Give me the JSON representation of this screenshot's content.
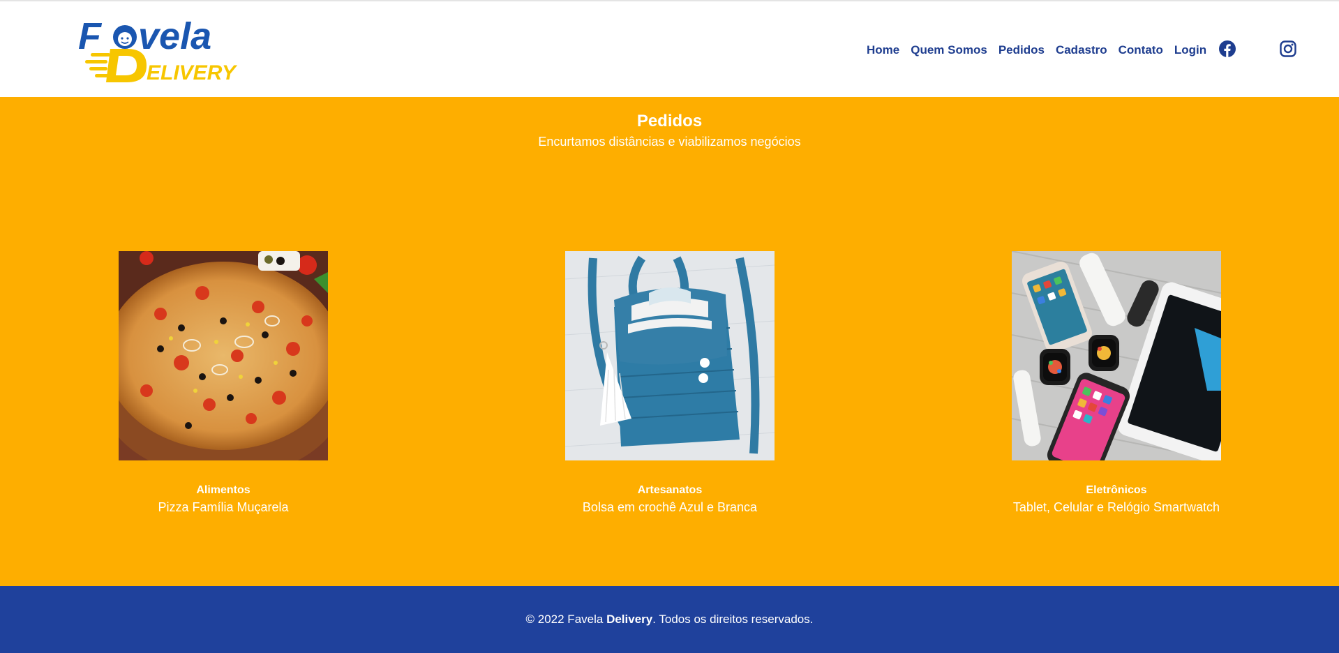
{
  "header": {
    "logo": {
      "word_top": "Favela",
      "word_bottom": "DELIVERY",
      "colors": {
        "blue": "#1a56b0",
        "yellow": "#f7c600"
      }
    },
    "nav": [
      "Home",
      "Quem Somos",
      "Pedidos",
      "Cadastro",
      "Contato",
      "Login"
    ],
    "social": [
      {
        "icon": "facebook-icon",
        "color": "#1e3d8f"
      },
      {
        "icon": "instagram-icon",
        "color": "#1e3d8f"
      }
    ]
  },
  "main": {
    "title": "Pedidos",
    "subtitle": "Encurtamos distâncias e viabilizamos negócios",
    "background": "#feae00",
    "products": [
      {
        "category": "Alimentos",
        "description": "Pizza Família Muçarela",
        "image": "pizza-image"
      },
      {
        "category": "Artesanatos",
        "description": "Bolsa em crochê Azul e Branca",
        "image": "crochet-bag-image"
      },
      {
        "category": "Eletrônicos",
        "description": "Tablet, Celular e Relógio Smartwatch",
        "image": "electronics-image"
      }
    ]
  },
  "footer": {
    "prefix": "© 2022 Favela ",
    "brand": "Delivery",
    "suffix": ". Todos os direitos reservados.",
    "background": "#1f419c"
  }
}
